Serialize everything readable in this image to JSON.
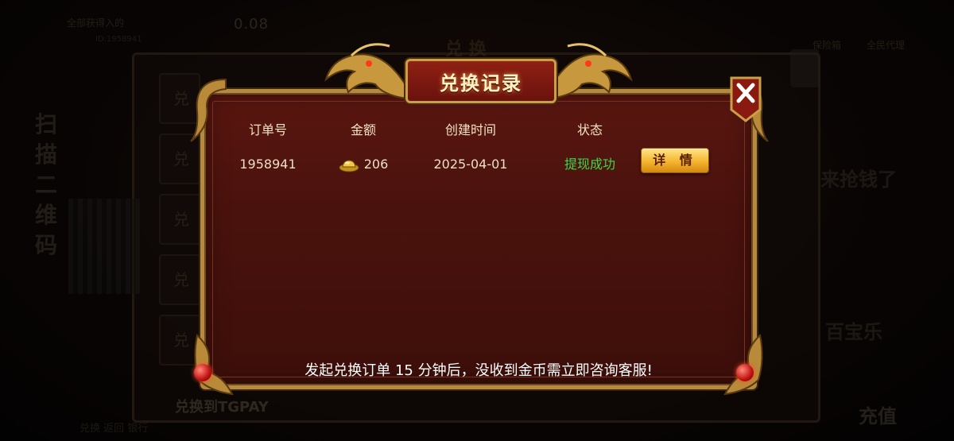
{
  "background": {
    "top_label": "全部获得入的",
    "top_id": "ID:1958941",
    "top_amount": "0.08",
    "panel_title": "兑 换",
    "right_label_a": "保险箱",
    "right_label_b": "全民代理",
    "vertical_text": "扫描二维码",
    "side_items": [
      "兑",
      "兑",
      "兑",
      "兑",
      "兑"
    ],
    "tgpay_label": "兑换到TGPAY",
    "bottom_label": "兑换   返回   银行",
    "right_big_1": "来抢钱了",
    "right_big_2": "百宝乐",
    "right_big_3": "充值"
  },
  "modal": {
    "title": "兑换记录",
    "columns": [
      "订单号",
      "金额",
      "创建时间",
      "状态"
    ],
    "rows": [
      {
        "order_id": "1958941",
        "amount": "206",
        "created": "2025-04-01",
        "status": "提现成功",
        "detail_label": "详 情"
      }
    ],
    "notice": "发起兑换订单 15 分钟后，没收到金币需立即咨询客服!"
  },
  "colors": {
    "status_success": "#3ad94a",
    "frame_gold": "#b38a40",
    "panel_red": "#4a120d",
    "button_gold": "#f5b52e"
  },
  "icons": [
    "dragon-icon",
    "gold-ingot-icon",
    "close-icon",
    "red-orb-icon"
  ]
}
